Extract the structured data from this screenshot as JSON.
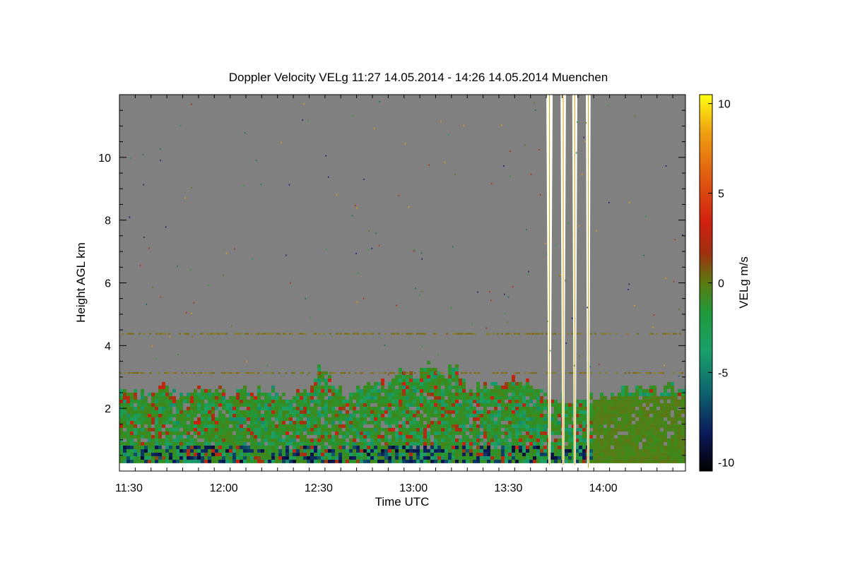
{
  "chart_data": {
    "type": "heatmap",
    "title": "Doppler Velocity VELg   11:27 14.05.2014 - 14:26 14.05.2014 Muenchen",
    "xlabel": "Time UTC",
    "ylabel": "Height AGL km",
    "colorbar_label": "VELg m/s",
    "x_range_minutes_utc": [
      687,
      866
    ],
    "y_range_km": [
      0,
      12
    ],
    "x_ticks": [
      {
        "label": "11:30",
        "minutes": 690
      },
      {
        "label": "12:00",
        "minutes": 720
      },
      {
        "label": "12:30",
        "minutes": 750
      },
      {
        "label": "13:00",
        "minutes": 780
      },
      {
        "label": "13:30",
        "minutes": 810
      },
      {
        "label": "14:00",
        "minutes": 840
      }
    ],
    "y_ticks": [
      {
        "label": "2",
        "value": 2
      },
      {
        "label": "4",
        "value": 4
      },
      {
        "label": "6",
        "value": 6
      },
      {
        "label": "8",
        "value": 8
      },
      {
        "label": "10",
        "value": 10
      }
    ],
    "colorbar_ticks": [
      {
        "label": "10",
        "value": 10
      },
      {
        "label": "5",
        "value": 5
      },
      {
        "label": "0",
        "value": 0
      },
      {
        "label": "-5",
        "value": -5
      },
      {
        "label": "-10",
        "value": -10
      }
    ],
    "color_range": [
      -10.5,
      10.5
    ],
    "colormap": [
      "#000000",
      "#0a1a5a",
      "#0e6a6e",
      "#1aa06a",
      "#1e9a3a",
      "#3a8a1a",
      "#6a7010",
      "#a03010",
      "#d02010",
      "#e05a10",
      "#f0a010",
      "#ffff10"
    ],
    "no_signal_color": "#808080",
    "gap_color": "#ffffff",
    "boundary_layer_top_km": [
      {
        "minutes": 687,
        "km": 2.5
      },
      {
        "minutes": 693,
        "km": 2.3
      },
      {
        "minutes": 699,
        "km": 2.7
      },
      {
        "minutes": 705,
        "km": 2.4
      },
      {
        "minutes": 711,
        "km": 2.6
      },
      {
        "minutes": 717,
        "km": 2.5
      },
      {
        "minutes": 723,
        "km": 2.4
      },
      {
        "minutes": 729,
        "km": 2.6
      },
      {
        "minutes": 735,
        "km": 2.5
      },
      {
        "minutes": 741,
        "km": 2.3
      },
      {
        "minutes": 747,
        "km": 2.6
      },
      {
        "minutes": 750,
        "km": 3.3
      },
      {
        "minutes": 754,
        "km": 2.8
      },
      {
        "minutes": 759,
        "km": 2.4
      },
      {
        "minutes": 765,
        "km": 2.6
      },
      {
        "minutes": 771,
        "km": 2.7
      },
      {
        "minutes": 776,
        "km": 3.2
      },
      {
        "minutes": 780,
        "km": 2.9
      },
      {
        "minutes": 784,
        "km": 3.3
      },
      {
        "minutes": 788,
        "km": 3.0
      },
      {
        "minutes": 792,
        "km": 3.4
      },
      {
        "minutes": 796,
        "km": 2.7
      },
      {
        "minutes": 801,
        "km": 2.6
      },
      {
        "minutes": 806,
        "km": 2.7
      },
      {
        "minutes": 812,
        "km": 2.9
      },
      {
        "minutes": 817,
        "km": 2.7
      },
      {
        "minutes": 822,
        "km": 2.4
      },
      {
        "minutes": 828,
        "km": 2.2
      },
      {
        "minutes": 834,
        "km": 2.3
      },
      {
        "minutes": 840,
        "km": 2.4
      },
      {
        "minutes": 846,
        "km": 2.6
      },
      {
        "minutes": 852,
        "km": 2.5
      },
      {
        "minutes": 858,
        "km": 2.6
      },
      {
        "minutes": 866,
        "km": 2.6
      }
    ],
    "precipitation_gaps_minutes": [
      {
        "start": 822,
        "end": 824,
        "bottom_km": 0.2
      },
      {
        "start": 826.5,
        "end": 828.2,
        "bottom_km": 0.2
      },
      {
        "start": 830.2,
        "end": 831.8,
        "bottom_km": 0.2
      },
      {
        "start": 834.5,
        "end": 836,
        "bottom_km": 0.1
      }
    ],
    "elevated_layer_km": [
      3.15,
      4.4
    ],
    "grid": false
  }
}
